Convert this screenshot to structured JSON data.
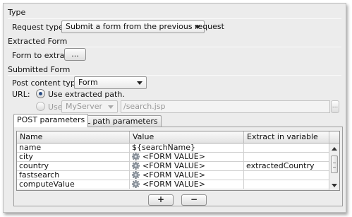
{
  "type_section": {
    "title": "Type",
    "request_type_label": "Request type:",
    "request_type_value": "Submit a form from the previous request"
  },
  "extracted_form": {
    "title": "Extracted Form",
    "form_to_extract_label": "Form to extract",
    "browse_label": "..."
  },
  "submitted_form": {
    "title": "Submitted Form",
    "post_content_type_label": "Post content type:",
    "post_content_type_value": "Form",
    "url_label": "URL:",
    "use_extracted_label": "Use extracted path.",
    "use_label": "Use:",
    "server_value": "MyServer",
    "path_value": "/search.jsp",
    "path_browse_label": "..."
  },
  "tabs": [
    {
      "label": "POST parameters",
      "active": true
    },
    {
      "label": "URL path parameters",
      "active": false
    }
  ],
  "table": {
    "columns": [
      "Name",
      "Value",
      "Extract in variable"
    ],
    "rows": [
      {
        "name": "name",
        "value": "${searchName}",
        "icon": null,
        "extract": ""
      },
      {
        "name": "city",
        "value": "<FORM VALUE>",
        "icon": "gear-icon",
        "extract": ""
      },
      {
        "name": "country",
        "value": "<FORM VALUE>",
        "icon": "gear-icon",
        "extract": "extractedCountry"
      },
      {
        "name": "fastsearch",
        "value": "<FORM VALUE>",
        "icon": "gear-icon",
        "extract": ""
      },
      {
        "name": "computeValue",
        "value": "<FORM VALUE>",
        "icon": "gear-icon",
        "extract": ""
      }
    ]
  },
  "buttons": {
    "add": "+",
    "remove": "−"
  }
}
